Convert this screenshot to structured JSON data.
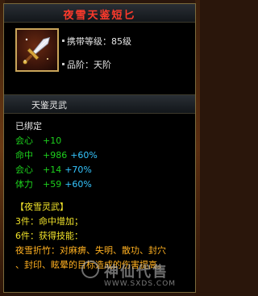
{
  "item": {
    "title": "夜雪天鉴短匕",
    "requirement": "携带等级：85级",
    "grade": "品阶：天阶",
    "set_name": "天鉴灵武"
  },
  "status": {
    "bound": "已绑定"
  },
  "stats": [
    {
      "label": "会心",
      "value": "+10",
      "bonus": ""
    },
    {
      "label": "命中",
      "value": "+986",
      "bonus": "+60%"
    },
    {
      "label": "会心",
      "value": "+14",
      "bonus": "+70%"
    },
    {
      "label": "体力",
      "value": "+59",
      "bonus": "+60%"
    }
  ],
  "set_bonus": {
    "header": "【夜雪灵武】",
    "tier3": "3件：命中增加；",
    "tier6": "6件：获得技能：",
    "skill_line1": "夜雪折竹：对麻痹、失明、散功、封穴",
    "skill_line2": "、封印、眩晕的目标造成的伤害提高。"
  },
  "watermark": {
    "text": "神仙代售",
    "url": "WWW.SXDS.COM"
  },
  "colors": {
    "title": "#ff3a2c",
    "stat_green": "#1dd11d",
    "bonus_cyan": "#35c6ff",
    "set_header": "#f1e32a",
    "skill_orange": "#ffb020",
    "frame_gold": "#c9a55a"
  },
  "icons": {
    "item": "dagger-icon"
  }
}
